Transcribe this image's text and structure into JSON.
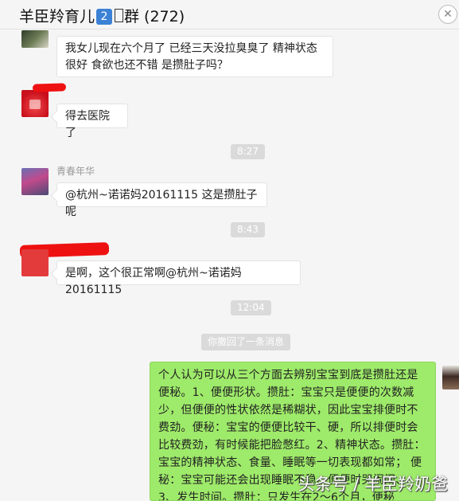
{
  "header": {
    "title_prefix": "羊臣羚育儿",
    "title_badge": "2",
    "title_suffix": "群 (272)",
    "close_label": "✕"
  },
  "messages": [
    {
      "text": "我女儿现在六个月了 已经三天没拉臭臭了 精神状态很好 食欲也还不错 是攒肚子吗？"
    },
    {
      "text": "得去医院了"
    },
    {
      "sender": "青春年华",
      "text": "@杭州~诺诺妈20161115 这是攒肚子呢"
    },
    {
      "text": "是啊，这个很正常啊@杭州~诺诺妈20161115"
    }
  ],
  "times": [
    "8:27",
    "8:43",
    "12:04"
  ],
  "recall_notice": "你撤回了一条消息",
  "my_message": "个人认为可以从三个方面去辨别宝宝到底是攒肚还是便秘。1、便便形状。攒肚：宝宝只是便便的次数减少，但便便的性状依然是稀糊状，因此宝宝排便时不费劲。便秘：宝宝的便便比较干、硬，所以排便时会比较费劲，有时候能把脸憋红。2、精神状态。攒肚：宝宝的精神状态、食量、睡眠等一切表现都如常； 便秘：宝宝可能还会出现睡眠不稳、便便时哭闹闹、 3、发生时间。攒肚：只发生在2～6个月，便秘",
  "watermark": "头条号 / 羊臣羚奶爸",
  "colors": {
    "my_bubble": "#9eea6a",
    "badge": "#3b82d6",
    "redaction": "#ee1111"
  }
}
